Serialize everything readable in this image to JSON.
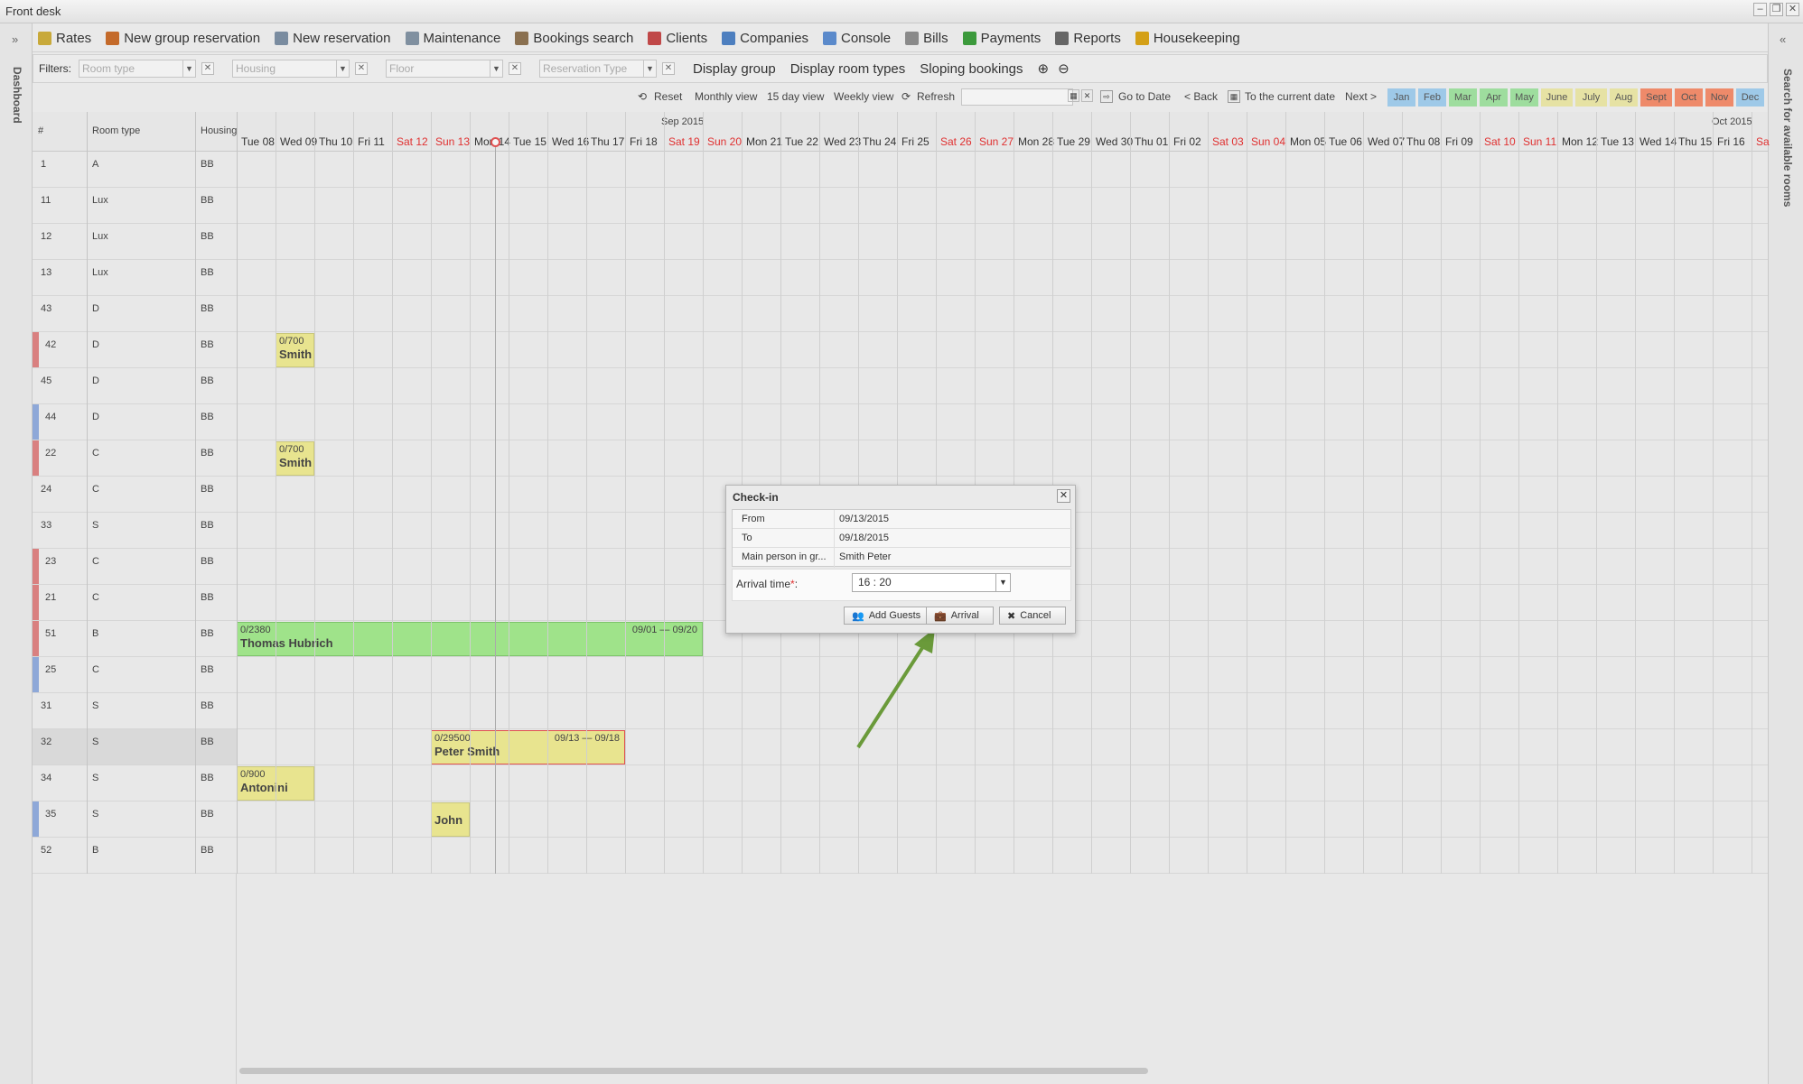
{
  "window": {
    "title": "Front desk",
    "min": "–",
    "restore": "❐",
    "close": "✕"
  },
  "left_panel": {
    "label": "Dashboard",
    "expand": "»"
  },
  "right_panel": {
    "label": "Search for available rooms",
    "expand": "«"
  },
  "menu": [
    {
      "label": "Rates",
      "icon": "chart-icon",
      "color": "#c8a93a"
    },
    {
      "label": "New group reservation",
      "icon": "group-icon",
      "color": "#c46a2a"
    },
    {
      "label": "New reservation",
      "icon": "pencil-icon",
      "color": "#7a8ca0"
    },
    {
      "label": "Maintenance",
      "icon": "wrench-icon",
      "color": "#8090a0"
    },
    {
      "label": "Bookings search",
      "icon": "magnifier-icon",
      "color": "#8a7050"
    },
    {
      "label": "Clients",
      "icon": "clients-icon",
      "color": "#c04848"
    },
    {
      "label": "Companies",
      "icon": "building-icon",
      "color": "#4d7fbf"
    },
    {
      "label": "Console",
      "icon": "window-icon",
      "color": "#5b8acb"
    },
    {
      "label": "Bills",
      "icon": "document-icon",
      "color": "#8a8a8a"
    },
    {
      "label": "Payments",
      "icon": "dollar-icon",
      "color": "#3c9a3c"
    },
    {
      "label": "Reports",
      "icon": "printer-icon",
      "color": "#666666"
    },
    {
      "label": "Housekeeping",
      "icon": "broom-icon",
      "color": "#d4a017"
    }
  ],
  "filters": {
    "label": "Filters:",
    "room_type": "Room type",
    "housing": "Housing",
    "floor": "Floor",
    "reservation_type": "Reservation Type",
    "display_group": "Display group",
    "display_room_types": "Display room types",
    "sloping_bookings": "Sloping bookings",
    "zoom_in": "⊕",
    "zoom_out": "⊖"
  },
  "nav": {
    "reset": "Reset",
    "monthly": "Monthly view",
    "fifteen": "15 day view",
    "weekly": "Weekly view",
    "refresh": "Refresh",
    "go_to_date": "Go to Date",
    "back": "< Back",
    "current": "To the current date",
    "next": "Next >",
    "months": [
      {
        "label": "Jan",
        "color": "#9ec9e8"
      },
      {
        "label": "Feb",
        "color": "#9ec9e8"
      },
      {
        "label": "Mar",
        "color": "#9edd9e"
      },
      {
        "label": "Apr",
        "color": "#9edd9e"
      },
      {
        "label": "May",
        "color": "#9edd9e"
      },
      {
        "label": "June",
        "color": "#e6e2a4"
      },
      {
        "label": "July",
        "color": "#e6e2a4"
      },
      {
        "label": "Aug",
        "color": "#e6e2a4"
      },
      {
        "label": "Sept",
        "color": "#ee8a6a"
      },
      {
        "label": "Oct",
        "color": "#ee8a6a"
      },
      {
        "label": "Nov",
        "color": "#ee8a6a"
      },
      {
        "label": "Dec",
        "color": "#9ec9e8"
      }
    ]
  },
  "grid": {
    "col_num": "#",
    "col_type": "Room type",
    "col_housing": "Housing",
    "month1": "Sep 2015",
    "month2": "Oct 2015",
    "days": [
      {
        "d": "Tue 08",
        "we": false
      },
      {
        "d": "Wed 09",
        "we": false
      },
      {
        "d": "Thu 10",
        "we": false
      },
      {
        "d": "Fri 11",
        "we": false
      },
      {
        "d": "Sat 12",
        "we": true
      },
      {
        "d": "Sun 13",
        "we": true
      },
      {
        "d": "Mon 14",
        "we": false
      },
      {
        "d": "Tue 15",
        "we": false
      },
      {
        "d": "Wed 16",
        "we": false
      },
      {
        "d": "Thu 17",
        "we": false
      },
      {
        "d": "Fri 18",
        "we": false
      },
      {
        "d": "Sat 19",
        "we": true
      },
      {
        "d": "Sun 20",
        "we": true
      },
      {
        "d": "Mon 21",
        "we": false
      },
      {
        "d": "Tue 22",
        "we": false
      },
      {
        "d": "Wed 23",
        "we": false
      },
      {
        "d": "Thu 24",
        "we": false
      },
      {
        "d": "Fri 25",
        "we": false
      },
      {
        "d": "Sat 26",
        "we": true
      },
      {
        "d": "Sun 27",
        "we": true
      },
      {
        "d": "Mon 28",
        "we": false
      },
      {
        "d": "Tue 29",
        "we": false
      },
      {
        "d": "Wed 30",
        "we": false
      },
      {
        "d": "Thu 01",
        "we": false
      },
      {
        "d": "Fri 02",
        "we": false
      },
      {
        "d": "Sat 03",
        "we": true
      },
      {
        "d": "Sun 04",
        "we": true
      },
      {
        "d": "Mon 05",
        "we": false
      },
      {
        "d": "Tue 06",
        "we": false
      },
      {
        "d": "Wed 07",
        "we": false
      },
      {
        "d": "Thu 08",
        "we": false
      },
      {
        "d": "Fri 09",
        "we": false
      },
      {
        "d": "Sat 10",
        "we": true
      },
      {
        "d": "Sun 11",
        "we": true
      },
      {
        "d": "Mon 12",
        "we": false
      },
      {
        "d": "Tue 13",
        "we": false
      },
      {
        "d": "Wed 14",
        "we": false
      },
      {
        "d": "Thu 15",
        "we": false
      },
      {
        "d": "Fri 16",
        "we": false
      },
      {
        "d": "Sa",
        "we": true
      }
    ],
    "rooms": [
      {
        "num": "1",
        "type": "A",
        "housing": "BB",
        "flag": ""
      },
      {
        "num": "11",
        "type": "Lux",
        "housing": "BB",
        "flag": ""
      },
      {
        "num": "12",
        "type": "Lux",
        "housing": "BB",
        "flag": ""
      },
      {
        "num": "13",
        "type": "Lux",
        "housing": "BB",
        "flag": ""
      },
      {
        "num": "43",
        "type": "D",
        "housing": "BB",
        "flag": ""
      },
      {
        "num": "42",
        "type": "D",
        "housing": "BB",
        "flag": "#d98080"
      },
      {
        "num": "45",
        "type": "D",
        "housing": "BB",
        "flag": ""
      },
      {
        "num": "44",
        "type": "D",
        "housing": "BB",
        "flag": "#8ea8d8"
      },
      {
        "num": "22",
        "type": "C",
        "housing": "BB",
        "flag": "#d98080"
      },
      {
        "num": "24",
        "type": "C",
        "housing": "BB",
        "flag": ""
      },
      {
        "num": "33",
        "type": "S",
        "housing": "BB",
        "flag": ""
      },
      {
        "num": "23",
        "type": "C",
        "housing": "BB",
        "flag": "#d98080"
      },
      {
        "num": "21",
        "type": "C",
        "housing": "BB",
        "flag": "#d98080"
      },
      {
        "num": "51",
        "type": "B",
        "housing": "BB",
        "flag": "#d98080"
      },
      {
        "num": "25",
        "type": "C",
        "housing": "BB",
        "flag": "#8ea8d8"
      },
      {
        "num": "31",
        "type": "S",
        "housing": "BB",
        "flag": ""
      },
      {
        "num": "32",
        "type": "S",
        "housing": "BB",
        "flag": ""
      },
      {
        "num": "34",
        "type": "S",
        "housing": "BB",
        "flag": ""
      },
      {
        "num": "35",
        "type": "S",
        "housing": "BB",
        "flag": "#8ea8d8"
      },
      {
        "num": "52",
        "type": "B",
        "housing": "BB",
        "flag": ""
      }
    ],
    "bookings": [
      {
        "row": 5,
        "start": 1,
        "len": 1,
        "amount": "0/700",
        "name": "Smith",
        "dates": "",
        "color": "#e8e48f",
        "border": "#c9c77c"
      },
      {
        "row": 8,
        "start": 1,
        "len": 1,
        "amount": "0/700",
        "name": "Smith",
        "dates": "",
        "color": "#e8e48f",
        "border": "#c9c77c"
      },
      {
        "row": 13,
        "start": 0,
        "len": 12,
        "amount": "0/2380",
        "name": "Thomas Hubrich",
        "dates": "09/01 — 09/20",
        "color": "#9fe38a",
        "border": "#7cc46a"
      },
      {
        "row": 16,
        "start": 5,
        "len": 5,
        "amount": "0/29500",
        "name": "Peter Smith",
        "dates": "09/13 — 09/18",
        "color": "#e8e48f",
        "border": "#e05050"
      },
      {
        "row": 17,
        "start": 0,
        "len": 2,
        "amount": "0/900",
        "name": "Antonini",
        "dates": "",
        "color": "#e8e48f",
        "border": "#c9c77c"
      },
      {
        "row": 18,
        "start": 5,
        "len": 1,
        "amount": "",
        "name": "John",
        "dates": "",
        "color": "#e8e48f",
        "border": "#c9c77c"
      }
    ]
  },
  "dialog": {
    "title": "Check-in",
    "close": "✕",
    "rows": [
      {
        "label": "From",
        "value": "09/13/2015"
      },
      {
        "label": "To",
        "value": "09/18/2015"
      },
      {
        "label": "Main person in gr...",
        "value": "Smith Peter"
      }
    ],
    "arrival_label": "Arrival time",
    "required": "*",
    "colon": ":",
    "arrival_value": "16 : 20",
    "add_guests": "Add Guests",
    "arrival": "Arrival",
    "cancel": "Cancel"
  },
  "colors": {
    "arrow": "#6a9a3a",
    "today_line": "#aaaaaa"
  }
}
